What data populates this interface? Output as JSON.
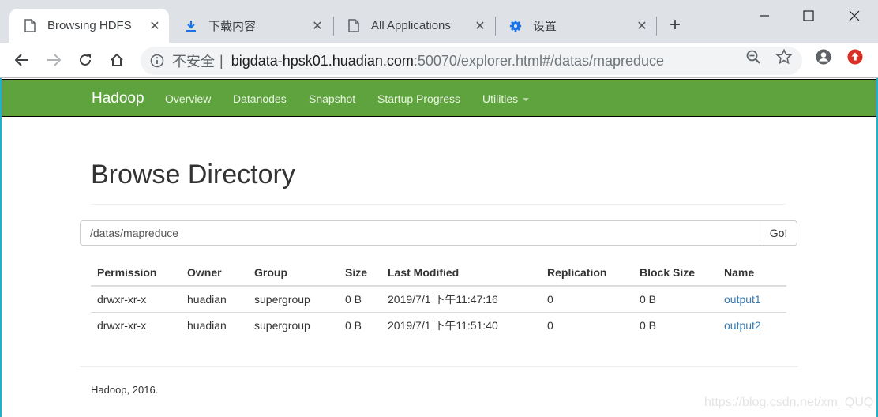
{
  "browser": {
    "tabs": [
      {
        "title": "Browsing HDFS",
        "icon": "page-icon",
        "active": true
      },
      {
        "title": "下载内容",
        "icon": "download-icon",
        "active": false
      },
      {
        "title": "All Applications",
        "icon": "page-icon",
        "active": false
      },
      {
        "title": "设置",
        "icon": "settings-gear-icon",
        "active": false
      }
    ],
    "new_tab_label": "+",
    "address": {
      "security_label": "不安全",
      "separator": "|",
      "host": "bigdata-hpsk01.huadian.com",
      "rest": ":50070/explorer.html#/datas/mapreduce"
    }
  },
  "navbar": {
    "brand": "Hadoop",
    "links": [
      "Overview",
      "Datanodes",
      "Snapshot",
      "Startup Progress",
      "Utilities"
    ]
  },
  "page": {
    "title": "Browse Directory",
    "path_value": "/datas/mapreduce",
    "go_label": "Go!",
    "table": {
      "headers": [
        "Permission",
        "Owner",
        "Group",
        "Size",
        "Last Modified",
        "Replication",
        "Block Size",
        "Name"
      ],
      "rows": [
        [
          "drwxr-xr-x",
          "huadian",
          "supergroup",
          "0 B",
          "2019/7/1 下午11:47:16",
          "0",
          "0 B",
          "output1"
        ],
        [
          "drwxr-xr-x",
          "huadian",
          "supergroup",
          "0 B",
          "2019/7/1 下午11:51:40",
          "0",
          "0 B",
          "output2"
        ]
      ]
    },
    "footer": "Hadoop, 2016.",
    "watermark": "https://blog.csdn.net/xm_QUQ"
  },
  "colors": {
    "navbar_bg": "#5fa33e",
    "link": "#337ab7",
    "tabstrip_bg": "#dee1e6"
  }
}
